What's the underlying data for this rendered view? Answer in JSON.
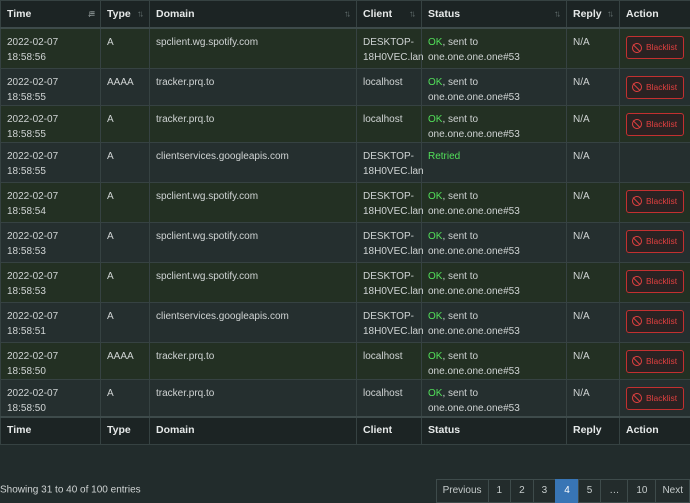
{
  "columns": {
    "time": "Time",
    "type": "Type",
    "domain": "Domain",
    "client": "Client",
    "status": "Status",
    "reply": "Reply",
    "action": "Action"
  },
  "sort_icons": {
    "time": "sort-descending-icon",
    "other": "sort-both-icon"
  },
  "rows": [
    {
      "time": "2022-02-07 18:58:56",
      "type": "A",
      "domain": "spclient.wg.spotify.com",
      "client": "DESKTOP-18H0VEC.lan",
      "status_ok": "OK",
      "status_rest": ", sent to one.one.one.one#53",
      "reply": "N/A",
      "action": "Blacklist"
    },
    {
      "time": "2022-02-07 18:58:55",
      "type": "AAAA",
      "domain": "tracker.prq.to",
      "client": "localhost",
      "status_ok": "OK",
      "status_rest": ", sent to one.one.one.one#53",
      "reply": "N/A",
      "action": "Blacklist"
    },
    {
      "time": "2022-02-07 18:58:55",
      "type": "A",
      "domain": "tracker.prq.to",
      "client": "localhost",
      "status_ok": "OK",
      "status_rest": ", sent to one.one.one.one#53",
      "reply": "N/A",
      "action": "Blacklist"
    },
    {
      "time": "2022-02-07 18:58:55",
      "type": "A",
      "domain": "clientservices.googleapis.com",
      "client": "DESKTOP-18H0VEC.lan",
      "status_ok": "Retried",
      "status_rest": "",
      "reply": "N/A",
      "action": ""
    },
    {
      "time": "2022-02-07 18:58:54",
      "type": "A",
      "domain": "spclient.wg.spotify.com",
      "client": "DESKTOP-18H0VEC.lan",
      "status_ok": "OK",
      "status_rest": ", sent to one.one.one.one#53",
      "reply": "N/A",
      "action": "Blacklist"
    },
    {
      "time": "2022-02-07 18:58:53",
      "type": "A",
      "domain": "spclient.wg.spotify.com",
      "client": "DESKTOP-18H0VEC.lan",
      "status_ok": "OK",
      "status_rest": ", sent to one.one.one.one#53",
      "reply": "N/A",
      "action": "Blacklist"
    },
    {
      "time": "2022-02-07 18:58:53",
      "type": "A",
      "domain": "spclient.wg.spotify.com",
      "client": "DESKTOP-18H0VEC.lan",
      "status_ok": "OK",
      "status_rest": ", sent to one.one.one.one#53",
      "reply": "N/A",
      "action": "Blacklist"
    },
    {
      "time": "2022-02-07 18:58:51",
      "type": "A",
      "domain": "clientservices.googleapis.com",
      "client": "DESKTOP-18H0VEC.lan",
      "status_ok": "OK",
      "status_rest": ", sent to one.one.one.one#53",
      "reply": "N/A",
      "action": "Blacklist"
    },
    {
      "time": "2022-02-07 18:58:50",
      "type": "AAAA",
      "domain": "tracker.prq.to",
      "client": "localhost",
      "status_ok": "OK",
      "status_rest": ", sent to one.one.one.one#53",
      "reply": "N/A",
      "action": "Blacklist"
    },
    {
      "time": "2022-02-07 18:58:50",
      "type": "A",
      "domain": "tracker.prq.to",
      "client": "localhost",
      "status_ok": "OK",
      "status_rest": ", sent to one.one.one.one#53",
      "reply": "N/A",
      "action": "Blacklist"
    }
  ],
  "footer": {
    "info": "Showing 31 to 40 of 100 entries",
    "pagination": {
      "previous": "Previous",
      "pages": [
        "1",
        "2",
        "3",
        "4",
        "5",
        "…",
        "10"
      ],
      "active": "4",
      "next": "Next"
    }
  },
  "colors": {
    "ok": "#52e05a",
    "blacklist": "#e04040",
    "active_page": "#3875b5"
  }
}
